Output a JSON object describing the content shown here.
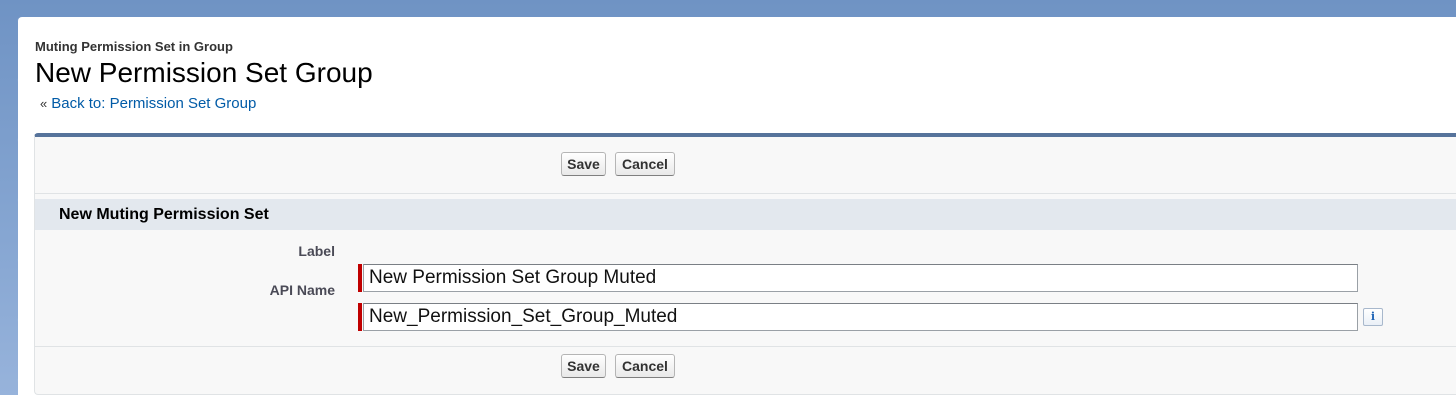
{
  "header": {
    "subtitle": "Muting Permission Set in Group",
    "title": "New Permission Set Group",
    "back_chevron": "«",
    "back_link": "Back to: Permission Set Group"
  },
  "toolbar": {
    "save_label": "Save",
    "cancel_label": "Cancel"
  },
  "section": {
    "title": "New Muting Permission Set"
  },
  "fields": {
    "label": {
      "label": "Label",
      "value": "New Permission Set Group Muted",
      "required": true
    },
    "api_name": {
      "label": "API Name",
      "value": "New_Permission_Set_Group_Muted",
      "required": true,
      "info_icon": "info-icon",
      "info_glyph": "i"
    }
  },
  "colors": {
    "panel_top_border": "#56739b",
    "section_header_bg": "#e3e8ee",
    "required_bar": "#c00000",
    "link": "#015ba7"
  }
}
